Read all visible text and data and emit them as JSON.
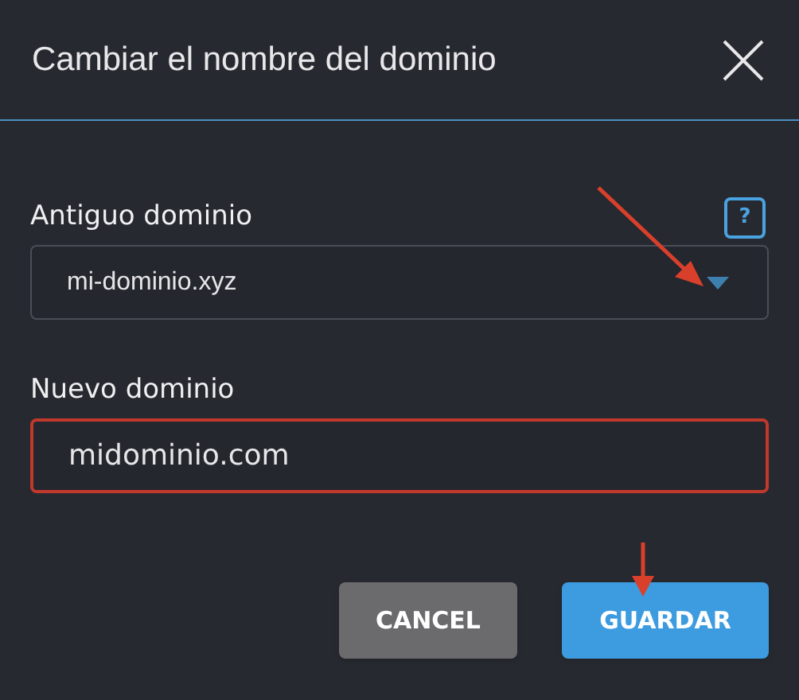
{
  "dialog": {
    "title": "Cambiar el nombre del dominio"
  },
  "fields": [
    {
      "kind": "select",
      "label": "Antiguo dominio",
      "value": "mi-dominio.xyz",
      "help": "?",
      "highlighted": false,
      "arrow": true
    },
    {
      "kind": "text",
      "label": "Nuevo dominio",
      "value": "midominio.com",
      "highlighted": true
    }
  ],
  "buttons": [
    {
      "label": "CANCEL",
      "kind": "secondary",
      "arrow": false
    },
    {
      "label": "GUARDAR",
      "kind": "primary",
      "arrow": true
    }
  ]
}
